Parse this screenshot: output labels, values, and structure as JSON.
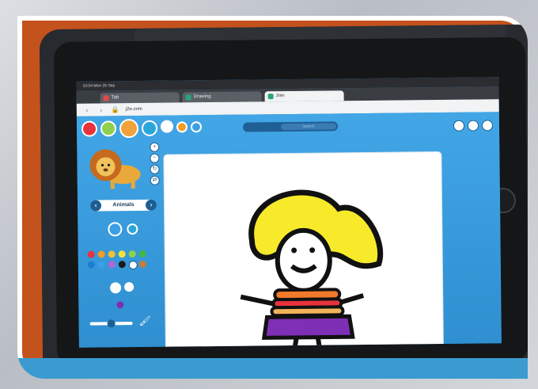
{
  "photo": {
    "description_colors": {
      "table": "#c3521d",
      "frame_band": "#3b9bd1"
    }
  },
  "device": {
    "status_time": "10:04  Mon 25 Sep"
  },
  "browser": {
    "tabs": [
      {
        "label": "Tab"
      },
      {
        "label": "Drawing"
      },
      {
        "label": "Join"
      }
    ],
    "url": "j2e.com"
  },
  "app": {
    "category_label": "Animals",
    "search_placeholder": "search",
    "palette": [
      "#e8323c",
      "#f59a23",
      "#f1c232",
      "#f3e33a",
      "#8fd14f",
      "#46b64b",
      "#1b7fd0",
      "#3aa0e6",
      "#b267d6",
      "#1b1b1b",
      "#ffffff",
      "#c97b3a"
    ],
    "brush_color": "#7d2fb5",
    "tool_colors": [
      "#e8323c",
      "#8fd14f",
      "#f1a23a",
      "#2aa5d8",
      "#ffffff",
      "#f59a23",
      "#ffffff"
    ]
  },
  "drawing": {
    "hair_color": "#f7ea2b",
    "stripe_colors": [
      "#f07a2a",
      "#e8323c",
      "#f2b35a",
      "#7d2fb5"
    ],
    "skirt_color": "#7d2fb5",
    "outline_color": "#111111"
  }
}
